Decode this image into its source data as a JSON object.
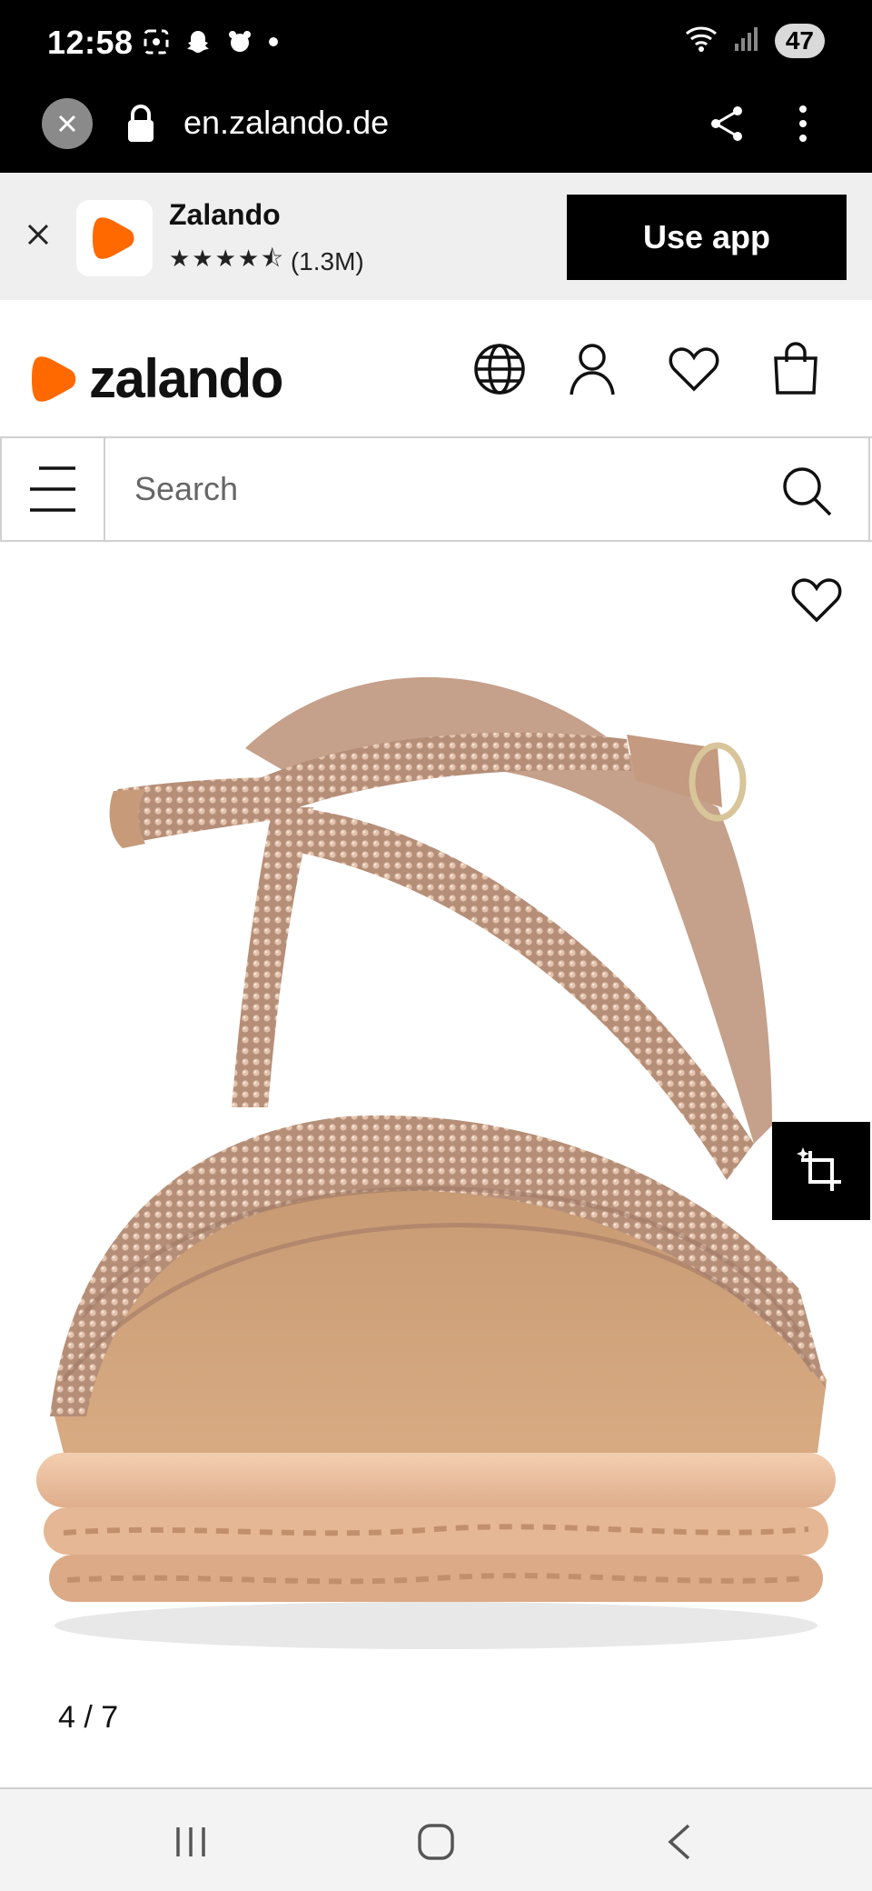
{
  "status_bar": {
    "time": "12:58",
    "battery": "47"
  },
  "browser": {
    "url": "en.zalando.de"
  },
  "app_banner": {
    "app_name": "Zalando",
    "stars": "★★★★⯪",
    "rating_count": "(1.3M)",
    "cta_label": "Use app"
  },
  "header": {
    "logo_text": "zalando",
    "brand_color": "#ff6900"
  },
  "search": {
    "placeholder": "Search"
  },
  "product_gallery": {
    "counter": "4 / 7"
  },
  "icons": {
    "header": [
      "globe-icon",
      "account-icon",
      "wishlist-icon",
      "bag-icon"
    ],
    "nav": [
      "recents-icon",
      "home-icon",
      "back-icon"
    ]
  }
}
